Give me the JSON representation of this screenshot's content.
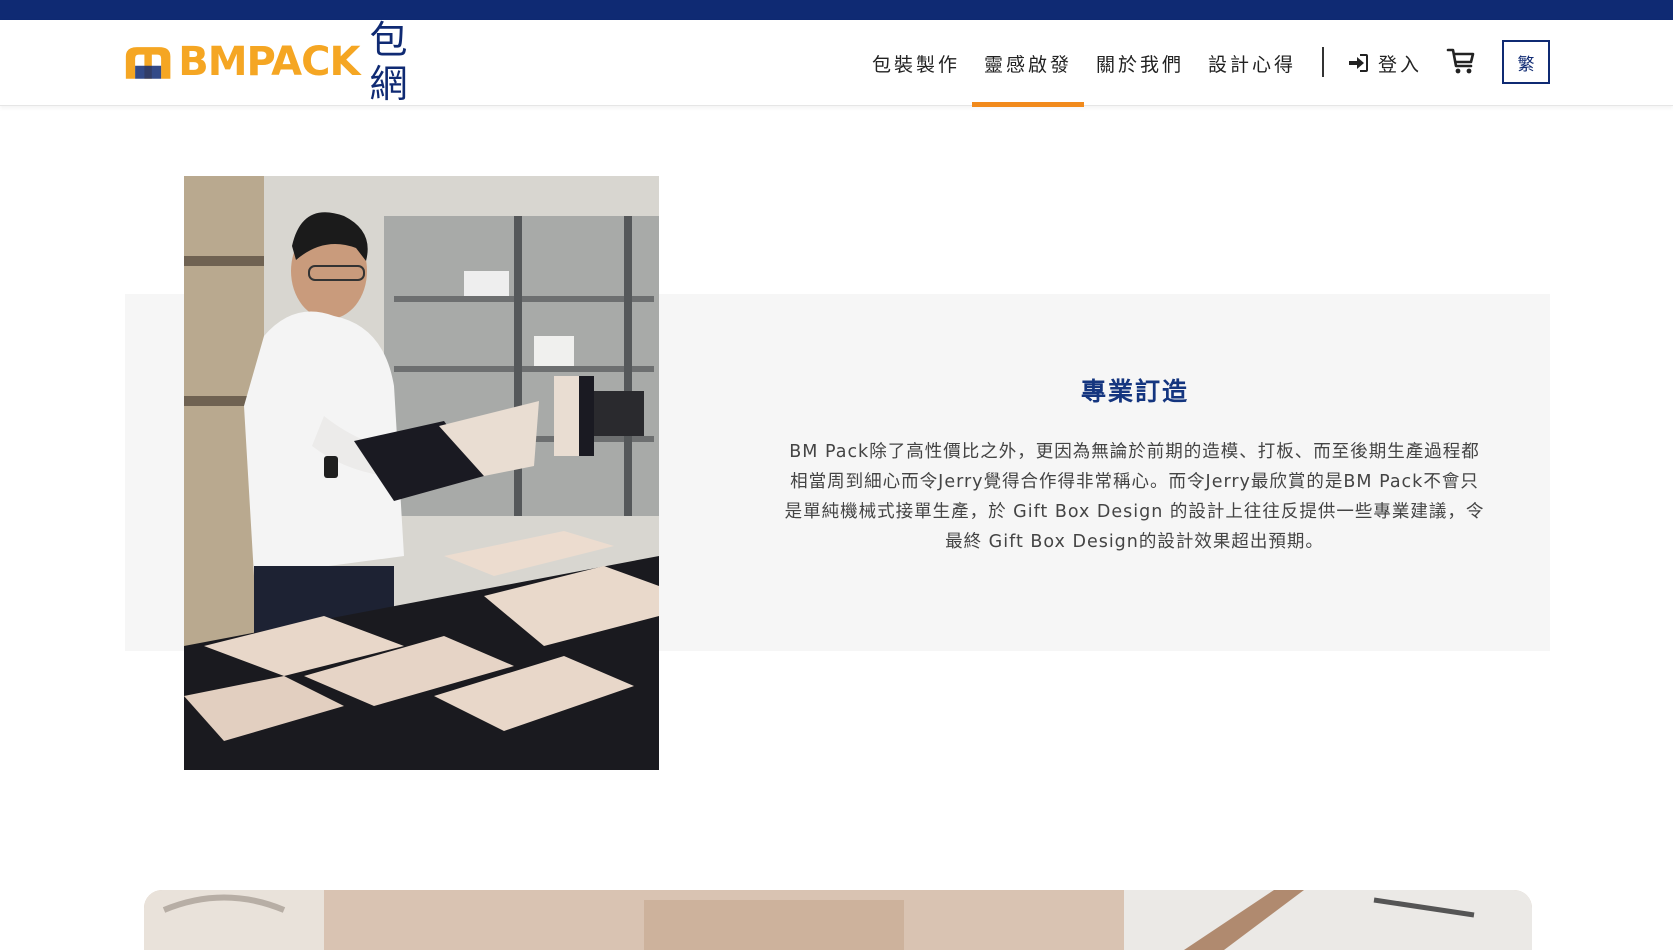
{
  "logo": {
    "wordmark": "BMPACK",
    "chinese": "包網"
  },
  "nav": {
    "items": [
      {
        "label": "包裝製作"
      },
      {
        "label": "靈感啟發",
        "active": true
      },
      {
        "label": "關於我們"
      },
      {
        "label": "設計心得"
      }
    ],
    "login_label": "登入",
    "lang_label": "繁"
  },
  "feature": {
    "title": "專業訂造",
    "body": "BM Pack除了高性價比之外，更因為無論於前期的造模、打板、而至後期生產過程都相當周到細心而令Jerry覺得合作得非常稱心。而令Jerry最欣賞的是BM Pack不會只是單純機械式接單生產，於 Gift Box Design 的設計上往往反提供一些專業建議，令最終 Gift Box Design的設計效果超出預期。"
  },
  "colors": {
    "brand_navy": "#0f2a73",
    "brand_orange": "#f18a1c",
    "panel_grey": "#f6f6f6"
  },
  "icons": {
    "login": "sign-in-icon",
    "cart": "cart-icon"
  }
}
